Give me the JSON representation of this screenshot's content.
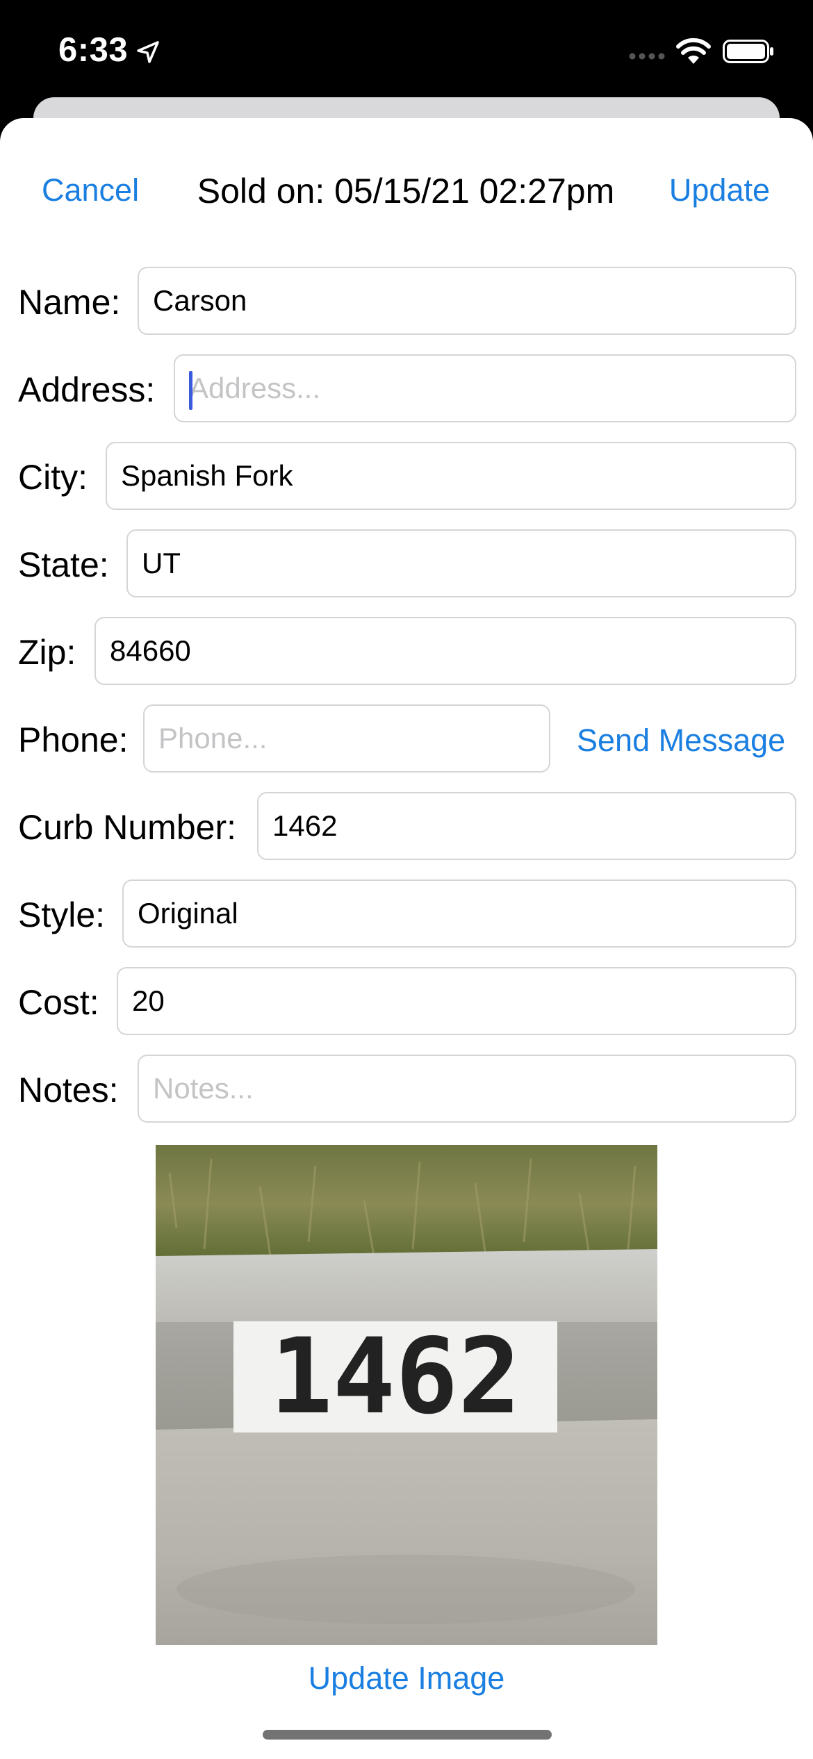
{
  "status_bar": {
    "time": "6:33"
  },
  "nav": {
    "cancel_label": "Cancel",
    "title": "Sold on: 05/15/21 02:27pm",
    "update_label": "Update"
  },
  "form": {
    "name": {
      "label": "Name:",
      "value": "Carson",
      "placeholder": ""
    },
    "address": {
      "label": "Address:",
      "value": "",
      "placeholder": "Address..."
    },
    "city": {
      "label": "City:",
      "value": "Spanish Fork",
      "placeholder": ""
    },
    "state": {
      "label": "State:",
      "value": "UT",
      "placeholder": ""
    },
    "zip": {
      "label": "Zip:",
      "value": "84660",
      "placeholder": ""
    },
    "phone": {
      "label": "Phone:",
      "value": "",
      "placeholder": "Phone...",
      "send_message_label": "Send Message"
    },
    "curb_number": {
      "label": "Curb Number:",
      "value": "1462",
      "placeholder": ""
    },
    "style": {
      "label": "Style:",
      "value": "Original",
      "placeholder": ""
    },
    "cost": {
      "label": "Cost:",
      "value": "20",
      "placeholder": ""
    },
    "notes": {
      "label": "Notes:",
      "value": "",
      "placeholder": "Notes..."
    }
  },
  "photo": {
    "curb_text": "1462"
  },
  "update_image_label": "Update Image",
  "colors": {
    "accent": "#1a7fe0",
    "cursor": "#3a5bdc"
  }
}
